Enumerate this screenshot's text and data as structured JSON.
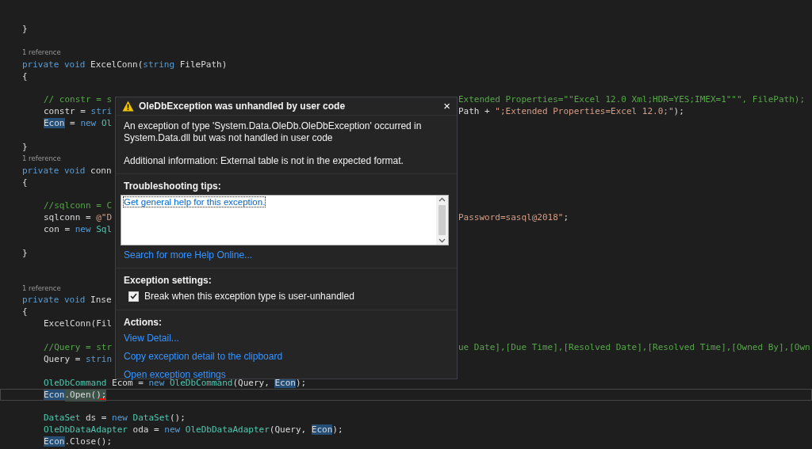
{
  "editor": {
    "lines": [
      {
        "kind": "code",
        "indented": false,
        "current": false,
        "segments": [
          {
            "text": "}",
            "kind": "plain"
          }
        ]
      },
      {
        "kind": "blank"
      },
      {
        "kind": "reference",
        "text": "1 reference"
      },
      {
        "kind": "code",
        "indented": false,
        "current": false,
        "segments": [
          {
            "text": "private void ",
            "kind": "keyword"
          },
          {
            "text": "ExcelConn(",
            "kind": "plain"
          },
          {
            "text": "string ",
            "kind": "keyword"
          },
          {
            "text": "FilePath)",
            "kind": "plain"
          }
        ]
      },
      {
        "kind": "code",
        "indented": false,
        "current": false,
        "segments": [
          {
            "text": "{",
            "kind": "plain"
          }
        ]
      },
      {
        "kind": "blank"
      },
      {
        "kind": "code",
        "indented": true,
        "current": false,
        "segments": [
          {
            "text": "// constr = s",
            "kind": "comment"
          }
        ],
        "right": [
          {
            "text": "Extended Properties=\"\"Excel 12.0 Xml;HDR=YES;IMEX=1\"\"\", FilePath);",
            "kind": "comment"
          }
        ]
      },
      {
        "kind": "code",
        "indented": true,
        "current": false,
        "segments": [
          {
            "text": "constr = ",
            "kind": "plain"
          },
          {
            "text": "stri",
            "kind": "keyword"
          }
        ],
        "right": [
          {
            "text": "Path + ",
            "kind": "plain"
          },
          {
            "text": "\";Extended Properties=Excel 12.0;\"",
            "kind": "string"
          },
          {
            "text": ");",
            "kind": "plain"
          }
        ]
      },
      {
        "kind": "code",
        "indented": true,
        "current": false,
        "segments": [
          {
            "text": "Econ",
            "kind": "reference"
          },
          {
            "text": " = ",
            "kind": "plain"
          },
          {
            "text": "new ",
            "kind": "keyword"
          },
          {
            "text": "Ol",
            "kind": "type"
          }
        ]
      },
      {
        "kind": "blank"
      },
      {
        "kind": "code",
        "indented": false,
        "current": false,
        "segments": [
          {
            "text": "}",
            "kind": "plain"
          }
        ]
      },
      {
        "kind": "reference",
        "text": "1 reference"
      },
      {
        "kind": "code",
        "indented": false,
        "current": false,
        "segments": [
          {
            "text": "private void ",
            "kind": "keyword"
          },
          {
            "text": "conn",
            "kind": "plain"
          }
        ]
      },
      {
        "kind": "code",
        "indented": false,
        "current": false,
        "segments": [
          {
            "text": "{",
            "kind": "plain"
          }
        ]
      },
      {
        "kind": "blank"
      },
      {
        "kind": "code",
        "indented": true,
        "current": false,
        "segments": [
          {
            "text": "//sqlconn = C",
            "kind": "comment"
          }
        ]
      },
      {
        "kind": "code",
        "indented": true,
        "current": false,
        "segments": [
          {
            "text": "sqlconn = ",
            "kind": "plain"
          },
          {
            "text": "@\"D",
            "kind": "string"
          }
        ],
        "right": [
          {
            "text": "Password=sasql@2018\"",
            "kind": "string"
          },
          {
            "text": ";",
            "kind": "plain"
          }
        ]
      },
      {
        "kind": "code",
        "indented": true,
        "current": false,
        "segments": [
          {
            "text": "con = ",
            "kind": "plain"
          },
          {
            "text": "new ",
            "kind": "keyword"
          },
          {
            "text": "Sql",
            "kind": "type"
          }
        ]
      },
      {
        "kind": "blank"
      },
      {
        "kind": "code",
        "indented": false,
        "current": false,
        "segments": [
          {
            "text": "}",
            "kind": "plain"
          }
        ]
      },
      {
        "kind": "blank"
      },
      {
        "kind": "blank"
      },
      {
        "kind": "reference",
        "text": "1 reference"
      },
      {
        "kind": "code",
        "indented": false,
        "current": false,
        "segments": [
          {
            "text": "private void ",
            "kind": "keyword"
          },
          {
            "text": "Inse",
            "kind": "plain"
          }
        ]
      },
      {
        "kind": "code",
        "indented": false,
        "current": false,
        "segments": [
          {
            "text": "{",
            "kind": "plain"
          }
        ]
      },
      {
        "kind": "code",
        "indented": true,
        "current": false,
        "segments": [
          {
            "text": "ExcelConn(Fil",
            "kind": "plain"
          }
        ]
      },
      {
        "kind": "blank"
      },
      {
        "kind": "code",
        "indented": true,
        "current": false,
        "segments": [
          {
            "text": "//Query = str",
            "kind": "comment"
          }
        ],
        "right": [
          {
            "text": "ue Date],[Due Time],[Resolved Date],[Resolved Time],[Owned By],[Own",
            "kind": "comment"
          }
        ]
      },
      {
        "kind": "code",
        "indented": true,
        "current": false,
        "segments": [
          {
            "text": "Query = ",
            "kind": "plain"
          },
          {
            "text": "strin",
            "kind": "keyword"
          }
        ]
      },
      {
        "kind": "blank"
      },
      {
        "kind": "code",
        "indented": true,
        "current": false,
        "segments": [
          {
            "text": "OleDbCommand",
            "kind": "type"
          },
          {
            "text": " Ecom = ",
            "kind": "plain"
          },
          {
            "text": "new ",
            "kind": "keyword"
          },
          {
            "text": "OleDbCommand",
            "kind": "type"
          },
          {
            "text": "(Query, ",
            "kind": "plain"
          },
          {
            "text": "Econ",
            "kind": "reference"
          },
          {
            "text": ");",
            "kind": "plain"
          }
        ]
      },
      {
        "kind": "code",
        "indented": true,
        "current": true,
        "segments": [
          {
            "text": "Econ",
            "kind": "reference"
          },
          {
            "text": ".Open();",
            "kind": "error"
          }
        ]
      },
      {
        "kind": "blank"
      },
      {
        "kind": "code",
        "indented": true,
        "current": false,
        "segments": [
          {
            "text": "DataSet",
            "kind": "type"
          },
          {
            "text": " ds = ",
            "kind": "plain"
          },
          {
            "text": "new ",
            "kind": "keyword"
          },
          {
            "text": "DataSet",
            "kind": "type"
          },
          {
            "text": "();",
            "kind": "plain"
          }
        ]
      },
      {
        "kind": "code",
        "indented": true,
        "current": false,
        "segments": [
          {
            "text": "OleDbDataAdapter",
            "kind": "type"
          },
          {
            "text": " oda = ",
            "kind": "plain"
          },
          {
            "text": "new ",
            "kind": "keyword"
          },
          {
            "text": "OleDbDataAdapter",
            "kind": "type"
          },
          {
            "text": "(Query, ",
            "kind": "plain"
          },
          {
            "text": "Econ",
            "kind": "reference"
          },
          {
            "text": ");",
            "kind": "plain"
          }
        ]
      },
      {
        "kind": "code",
        "indented": true,
        "current": false,
        "segments": [
          {
            "text": "Econ",
            "kind": "reference"
          },
          {
            "text": ".Close();",
            "kind": "plain"
          }
        ]
      }
    ]
  },
  "exception_popup": {
    "title": "OleDbException was unhandled by user code",
    "close": "×",
    "message": "An exception of type 'System.Data.OleDb.OleDbException' occurred in System.Data.dll but was not handled in user code",
    "additional_information": "Additional information: External table is not in the expected format.",
    "troubleshooting": {
      "heading": "Troubleshooting tips:",
      "tips": [
        "Get general help for this exception."
      ],
      "search_link": "Search for more Help Online..."
    },
    "settings": {
      "heading": "Exception settings:",
      "options": [
        {
          "label": "Break when this exception type is user-unhandled",
          "checked": true
        }
      ]
    },
    "actions": {
      "heading": "Actions:",
      "links": [
        "View Detail...",
        "Copy exception detail to the clipboard",
        "Open exception settings"
      ]
    }
  }
}
